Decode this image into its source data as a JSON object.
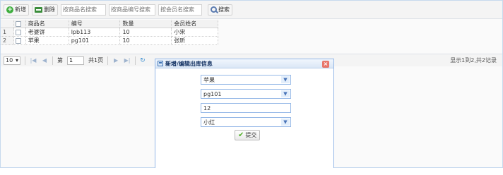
{
  "toolbar": {
    "add_label": "新增",
    "delete_label": "删除",
    "search_name_placeholder": "按商品名搜索",
    "search_code_placeholder": "按商品编号搜索",
    "search_member_placeholder": "按会员名搜索",
    "search_label": "搜索",
    "icons": {
      "add": "plus-circle-icon",
      "delete": "minus-icon",
      "search": "magnifier-icon"
    }
  },
  "table": {
    "headers": {
      "name": "商品名",
      "code": "编号",
      "qty": "数量",
      "member": "会员姓名"
    },
    "rows": [
      {
        "index": "1",
        "name": "老婆饼",
        "code": "lpb113",
        "qty": "10",
        "member": "小宋"
      },
      {
        "index": "2",
        "name": "苹果",
        "code": "pg101",
        "qty": "10",
        "member": "张昕"
      }
    ]
  },
  "pager": {
    "page_size": "10",
    "page_prefix": "第",
    "page_value": "1",
    "page_total": "共1页",
    "info": "显示1到2,共2记录"
  },
  "dialog": {
    "title": "新增/编辑出库信息",
    "product": "苹果",
    "code": "pg101",
    "quantity": "12",
    "member": "小红",
    "submit_label": "提交",
    "colors": {
      "border": "#95b8e7",
      "close": "#e8756a"
    }
  }
}
